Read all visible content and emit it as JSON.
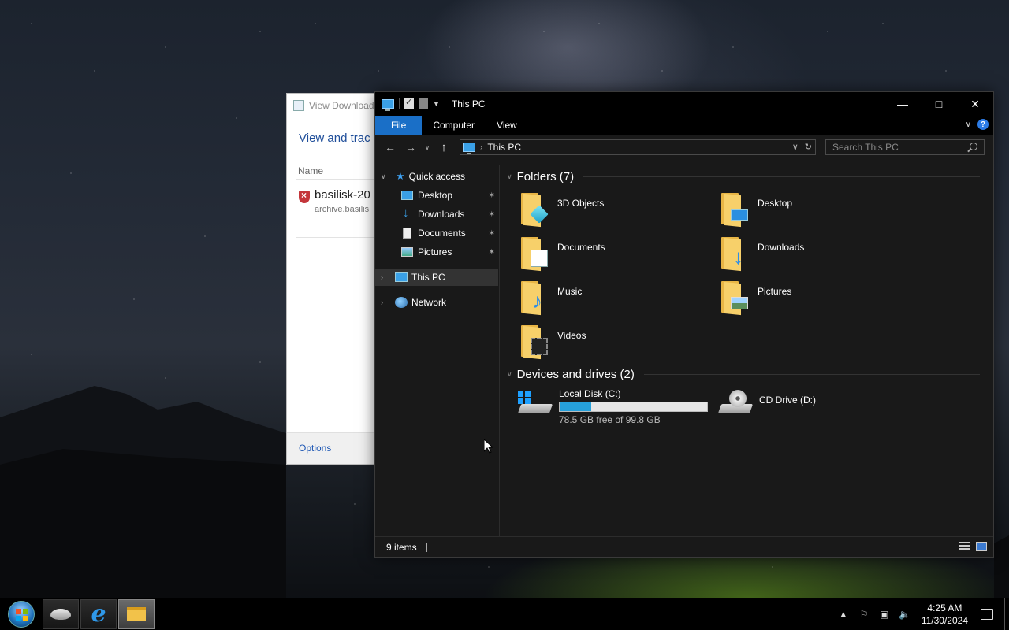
{
  "download_window": {
    "title": "View Download",
    "heading": "View and trac",
    "column_name": "Name",
    "item": {
      "filename": "basilisk-20",
      "url": "archive.basilis"
    },
    "options_label": "Options"
  },
  "explorer": {
    "title": "This PC",
    "ribbon_tabs": [
      "File",
      "Computer",
      "View"
    ],
    "help_label": "?",
    "address": {
      "crumb": "This PC"
    },
    "search_placeholder": "Search This PC",
    "nav_pane": {
      "quick_access": "Quick access",
      "quick_items": [
        "Desktop",
        "Downloads",
        "Documents",
        "Pictures"
      ],
      "this_pc": "This PC",
      "network": "Network"
    },
    "folders_group": "Folders (7)",
    "folders": [
      "3D Objects",
      "Desktop",
      "Documents",
      "Downloads",
      "Music",
      "Pictures",
      "Videos"
    ],
    "drives_group": "Devices and drives (2)",
    "drives": [
      {
        "name": "Local Disk (C:)",
        "detail": "78.5 GB free of 99.8 GB",
        "used_fraction": 0.213
      },
      {
        "name": "CD Drive (D:)"
      }
    ],
    "status": "9 items"
  },
  "taskbar": {
    "time": "4:25 AM",
    "date": "11/30/2024"
  },
  "colors": {
    "accent": "#1a6fc7",
    "drive_fill": "#26a0da",
    "link": "#1f58b5"
  }
}
